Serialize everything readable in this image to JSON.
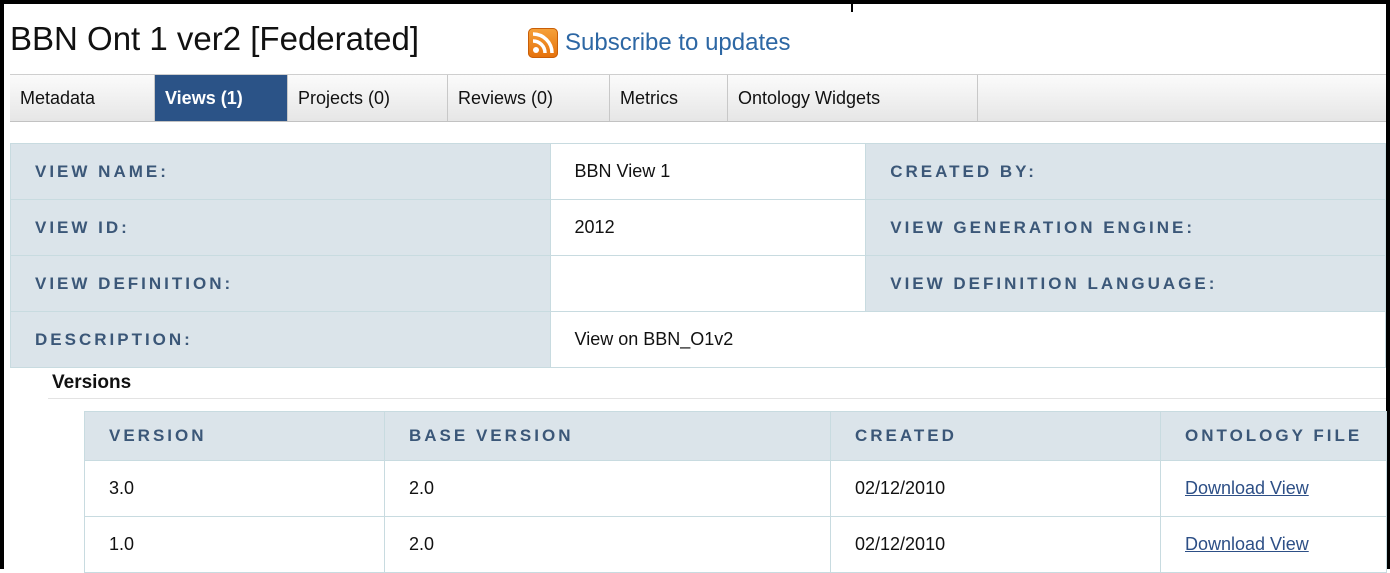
{
  "header": {
    "title": "BBN Ont 1 ver2 [Federated]",
    "subscribe_label": "Subscribe to updates",
    "subscribe_icon": "rss-icon"
  },
  "tabs": [
    {
      "label": "Metadata",
      "active": false
    },
    {
      "label": "Views (1)",
      "active": true
    },
    {
      "label": "Projects (0)",
      "active": false
    },
    {
      "label": "Reviews (0)",
      "active": false
    },
    {
      "label": "Metrics",
      "active": false
    },
    {
      "label": "Ontology Widgets",
      "active": false
    }
  ],
  "view_details": [
    {
      "label": "VIEW NAME:",
      "value": "BBN View 1",
      "label2": "CREATED BY:"
    },
    {
      "label": "VIEW ID:",
      "value": "2012",
      "label2": "VIEW GENERATION ENGINE:"
    },
    {
      "label": "VIEW DEFINITION:",
      "value": "",
      "label2": "VIEW DEFINITION LANGUAGE:"
    },
    {
      "label": "DESCRIPTION:",
      "value": "View on BBN_O1v2"
    }
  ],
  "versions": {
    "title": "Versions",
    "columns": [
      "VERSION",
      "BASE VERSION",
      "CREATED",
      "ONTOLOGY FILE"
    ],
    "rows": [
      {
        "version": "3.0",
        "base_version": "2.0",
        "created": "02/12/2010",
        "file_link": "Download View"
      },
      {
        "version": "1.0",
        "base_version": "2.0",
        "created": "02/12/2010",
        "file_link": "Download View"
      }
    ]
  },
  "colors": {
    "active_tab_bg": "#2b5387",
    "label_cell_bg": "#dbe4ea",
    "label_text": "#3b5778",
    "link": "#2d4f86"
  }
}
